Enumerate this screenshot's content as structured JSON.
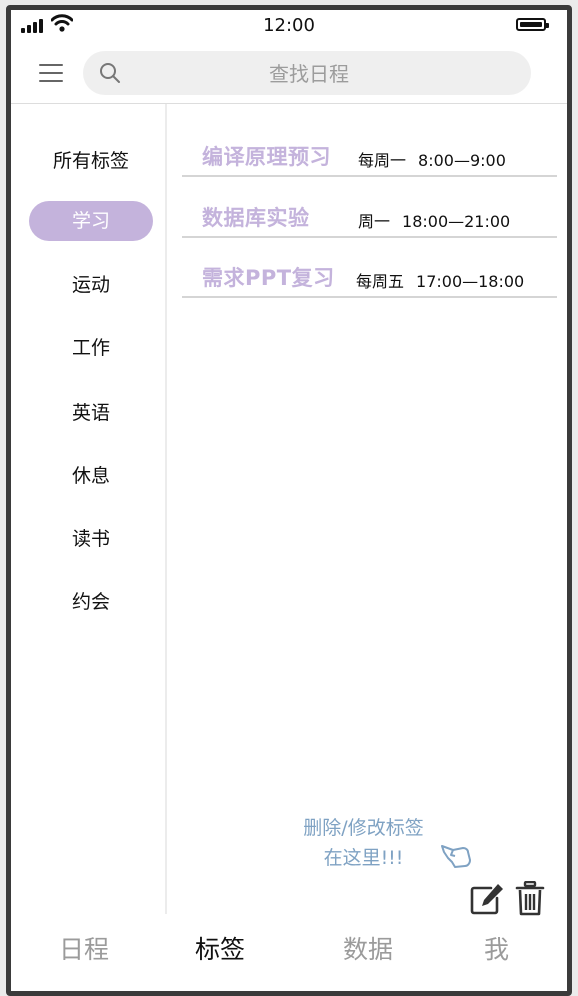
{
  "status_bar": {
    "time": "12:00"
  },
  "search": {
    "placeholder": "查找日程"
  },
  "sidebar": {
    "all_label": "所有标签",
    "items": [
      {
        "label": "学习",
        "active": true
      },
      {
        "label": "运动"
      },
      {
        "label": "工作"
      },
      {
        "label": "英语"
      },
      {
        "label": "休息"
      },
      {
        "label": "读书"
      },
      {
        "label": "约会"
      }
    ]
  },
  "schedules": [
    {
      "title": "编译原理预习",
      "repeat": "每周一",
      "time": "8:00—9:00"
    },
    {
      "title": "数据库实验",
      "repeat": "周一",
      "time": "18:00—21:00"
    },
    {
      "title": "需求PPT复习",
      "repeat": "每周五",
      "time": "17:00—18:00"
    }
  ],
  "hint": {
    "line1": "删除/修改标签",
    "line2": "在这里!!!"
  },
  "tabbar": {
    "tabs": [
      {
        "label": "日程"
      },
      {
        "label": "标签",
        "active": true
      },
      {
        "label": "数据"
      },
      {
        "label": "我"
      }
    ]
  },
  "colors": {
    "accent": "#c4b3dc",
    "hint": "#7fa2c3",
    "inactive_tab": "#9b9b9b",
    "frame": "#3b3b3b"
  },
  "icons": [
    "signal-icon",
    "wifi-icon",
    "battery-icon",
    "menu-icon",
    "search-icon",
    "pointing-hand-icon",
    "edit-icon",
    "trash-icon"
  ]
}
